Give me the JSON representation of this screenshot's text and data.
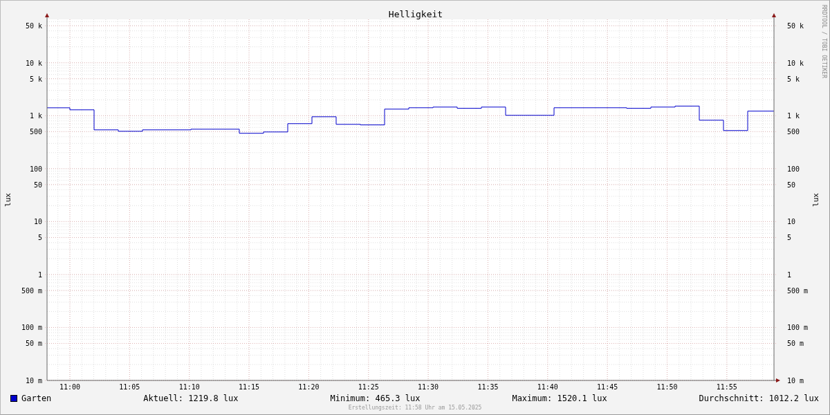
{
  "watermark": "RRDTOOL / TOBI OETIKER",
  "chart": {
    "title": "Helligkeit",
    "left_axis_title": "lux",
    "left_axis_labels": [
      "50 k",
      "10 k",
      "5 k",
      "1 k",
      "500",
      "100",
      "50",
      "10",
      "5",
      "1",
      "500 m",
      "100 m",
      "50 m",
      "10 m"
    ],
    "right_axis_labels": [
      "50 k",
      "10 k",
      "5 k",
      "1 k",
      "500",
      "100",
      "50",
      "10",
      "5",
      "1",
      "500 m",
      "100 m",
      "50 m",
      "10 m"
    ],
    "right_axis_title": "lux",
    "time_labels": [
      "11:00",
      "11:05",
      "11:10",
      "11:15",
      "11:20",
      "11:25",
      "11:30",
      "11:35",
      "11:40",
      "11:45",
      "11:50",
      "11:55"
    ]
  },
  "legend": {
    "series_name": "Garten",
    "color": "#0000cc",
    "stats": [
      "Aktuell: 1219.8 lux",
      "Minimum: 465.3 lux",
      "Maximum: 1520.1 lux",
      "Durchschnitt: 1012.2 lux"
    ]
  },
  "footer": "Erstellungszeit: 11:58 Uhr am 15.05.2025"
}
